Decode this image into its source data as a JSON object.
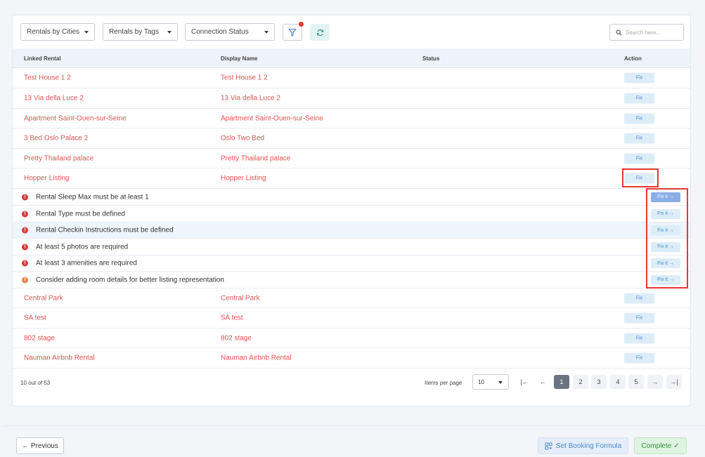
{
  "filters": {
    "cities_label": "Rentals by Cities",
    "tags_label": "Rentals by Tags",
    "status_label": "Connection Status",
    "search_placeholder": "Search here..."
  },
  "table": {
    "headers": [
      "Linked Rental",
      "Display Name",
      "Status",
      "Action"
    ],
    "fix_label": "Fix",
    "fixit_label": "Fix it →",
    "rows_top": [
      {
        "linked": "Test House 1 2",
        "display": "Test House 1 2"
      },
      {
        "linked": "13 Via della Luce 2",
        "display": "13 Via della Luce 2"
      },
      {
        "linked": "Apartment Saint-Ouen-sur-Seine",
        "display": "Apartment Saint-Ouen-sur-Seine"
      },
      {
        "linked": "3 Bed Oslo Palace 2",
        "display": "Oslo Two Bed"
      },
      {
        "linked": "Pretty Thailand palace",
        "display": "Pretty Thailand palace"
      },
      {
        "linked": "Hopper Listing",
        "display": "Hopper Listing"
      }
    ],
    "issues": [
      {
        "text": "Rental Sleep Max must be at least 1",
        "level": "error"
      },
      {
        "text": "Rental Type must be defined",
        "level": "error"
      },
      {
        "text": "Rental Checkin Instructions must be defined",
        "level": "error"
      },
      {
        "text": "At least 5 photos are required",
        "level": "error"
      },
      {
        "text": "At least 3 amenities are required",
        "level": "error"
      },
      {
        "text": "Consider adding room details for better listing representation",
        "level": "warning"
      }
    ],
    "rows_bottom": [
      {
        "linked": "Central Park",
        "display": "Central Park"
      },
      {
        "linked": "SA test",
        "display": "SA test"
      },
      {
        "linked": "802 stage",
        "display": "802 stage"
      },
      {
        "linked": "Nauman Airbnb Rental",
        "display": "Nauman Airbnb Rental"
      }
    ]
  },
  "pagination": {
    "count_text": "10 out of 53",
    "items_per_page_label": "Items per page",
    "items_per_page_value": "10",
    "first": "|←",
    "prev": "←",
    "pages": [
      "1",
      "2",
      "3",
      "4",
      "5"
    ],
    "current_page": "1",
    "next": "→",
    "last": "→|"
  },
  "actions": {
    "previous_label": "← Previous",
    "formula_label": "Set Booking Formula",
    "complete_label": "Complete ✓"
  },
  "colors": {
    "link_red": "#e05252",
    "fix_bg": "#dcedf8",
    "highlight_box": "#e53935"
  }
}
